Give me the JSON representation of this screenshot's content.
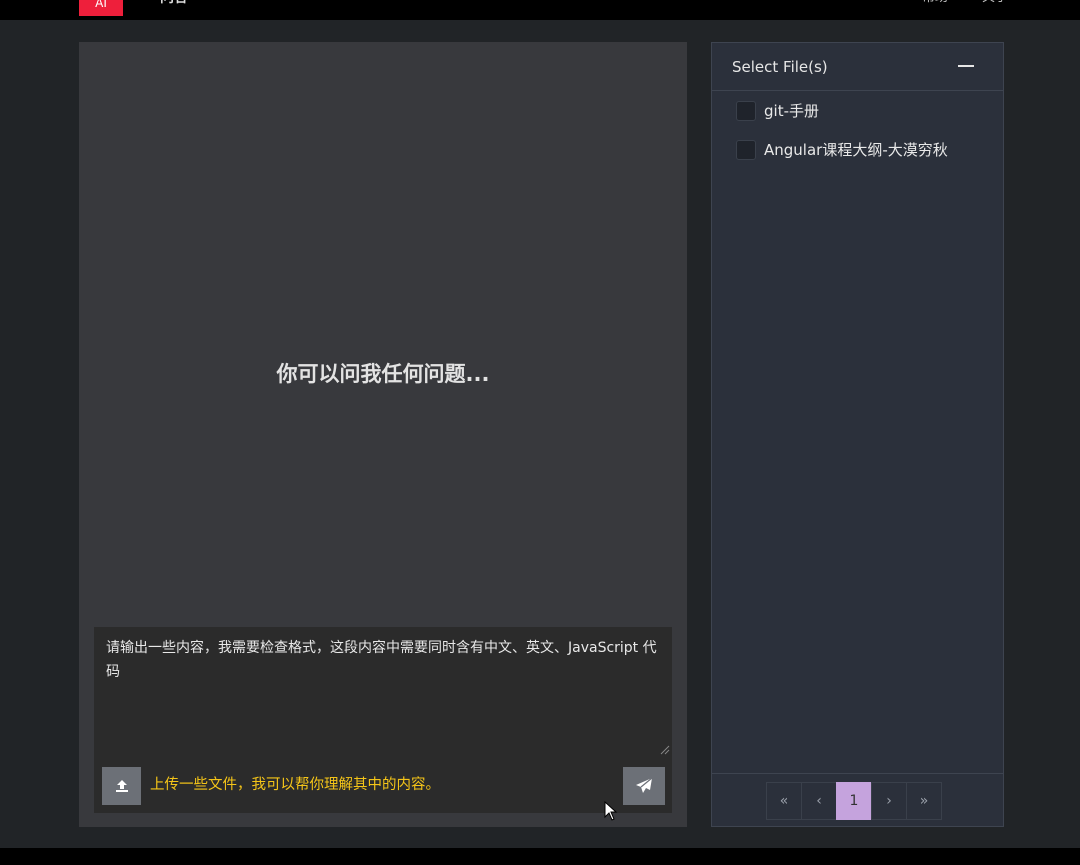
{
  "topbar": {
    "brand_logo_text": "AI",
    "brand_name": "问答",
    "links": [
      "帮助",
      "关于"
    ]
  },
  "chat": {
    "empty_hint": "你可以问我任何问题...",
    "composer": {
      "text": "请输出一些内容，我需要检查格式，这段内容中需要同时含有中文、英文、JavaScript 代码",
      "upload_hint": "上传一些文件，我可以帮你理解其中的内容。",
      "upload_icon": "upload-icon",
      "send_icon": "paper-plane-icon"
    }
  },
  "files": {
    "title": "Select File(s)",
    "items": [
      {
        "label": "git-手册",
        "checked": false
      },
      {
        "label": "Angular课程大纲-大漠穷秋",
        "checked": false
      }
    ],
    "pagination": {
      "first": "«",
      "prev": "‹",
      "current": "1",
      "next": "›",
      "last": "»"
    }
  },
  "colors": {
    "background": "#212427",
    "chat_panel": "#38393d",
    "file_panel": "#2b303b",
    "accent": "#c5a3dd",
    "hint": "#f5c518",
    "logo": "#ee1f3b"
  }
}
